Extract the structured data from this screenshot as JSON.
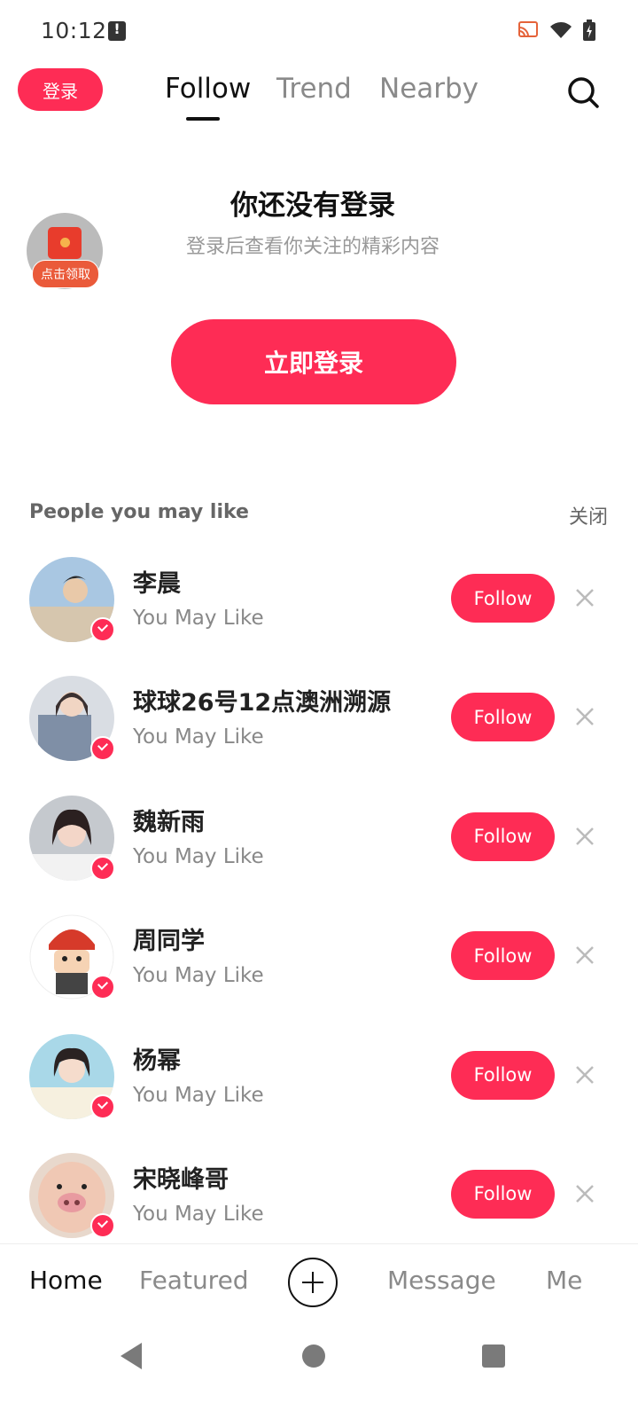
{
  "status_bar": {
    "time": "10:12"
  },
  "header": {
    "login_label": "登录",
    "tabs": [
      {
        "label": "Follow",
        "active": true
      },
      {
        "label": "Trend",
        "active": false
      },
      {
        "label": "Nearby",
        "active": false
      }
    ]
  },
  "promo": {
    "badge_label": "点击领取"
  },
  "prompt": {
    "title": "你还没有登录",
    "subtitle": "登录后查看你关注的精彩内容",
    "login_button": "立即登录"
  },
  "suggestions": {
    "title": "People you may like",
    "close_label": "关闭",
    "items": [
      {
        "name": "李晨",
        "subtitle": "You May Like",
        "follow_label": "Follow"
      },
      {
        "name": "球球26号12点澳洲溯源",
        "subtitle": "You May Like",
        "follow_label": "Follow"
      },
      {
        "name": "魏新雨",
        "subtitle": "You May Like",
        "follow_label": "Follow"
      },
      {
        "name": "周同学",
        "subtitle": "You May Like",
        "follow_label": "Follow"
      },
      {
        "name": "杨幂",
        "subtitle": "You May Like",
        "follow_label": "Follow"
      },
      {
        "name": "宋晓峰哥",
        "subtitle": "You May Like",
        "follow_label": "Follow"
      }
    ]
  },
  "bottom_nav": {
    "home": "Home",
    "featured": "Featured",
    "message": "Message",
    "me": "Me"
  },
  "colors": {
    "accent": "#fe2c55"
  }
}
